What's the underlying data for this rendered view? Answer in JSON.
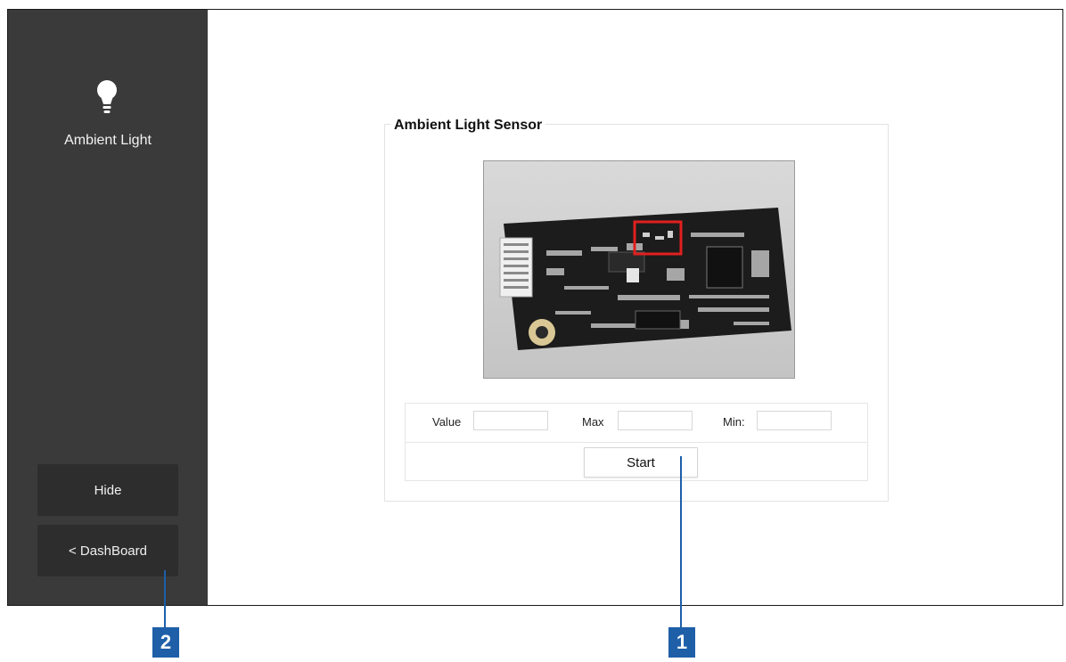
{
  "sidebar": {
    "title": "Ambient Light",
    "hide_label": "Hide",
    "dashboard_label": "< DashBoard"
  },
  "panel": {
    "title": "Ambient Light Sensor",
    "value_label": "Value",
    "max_label": "Max",
    "min_label": "Min:",
    "value": "",
    "max": "",
    "min": "",
    "start_label": "Start"
  },
  "callouts": {
    "one": "1",
    "two": "2"
  },
  "colors": {
    "sidebar_bg": "#3a3a3a",
    "callout": "#1e5fa8",
    "highlight": "#e0201e"
  },
  "icons": [
    "lightbulb-icon"
  ]
}
